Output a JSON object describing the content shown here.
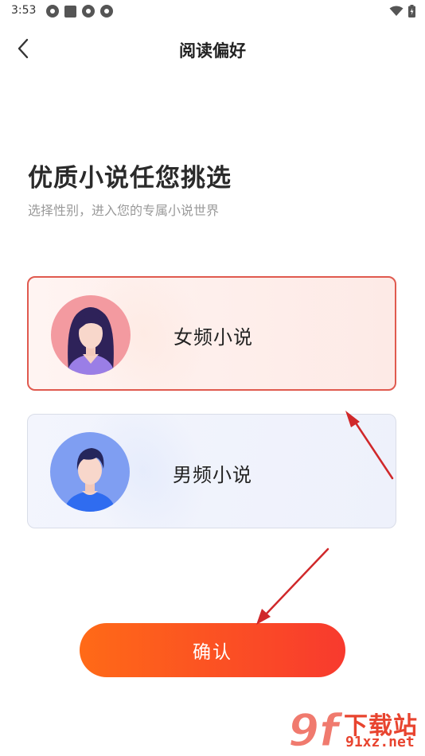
{
  "status_bar": {
    "time": "3:53"
  },
  "header": {
    "title": "阅读偏好"
  },
  "intro": {
    "headline": "优质小说任您挑选",
    "subheadline": "选择性别，进入您的专属小说世界"
  },
  "options": [
    {
      "label": "女频小说",
      "selected": true
    },
    {
      "label": "男频小说",
      "selected": false
    }
  ],
  "confirm": {
    "label": "确认"
  },
  "watermark": {
    "logo_text": "9f",
    "title": "下载站",
    "url": "91xz.net"
  },
  "colors": {
    "accent": "#f8542a",
    "selected_border": "#e05a4f",
    "annotation_arrow": "#d0282a"
  }
}
